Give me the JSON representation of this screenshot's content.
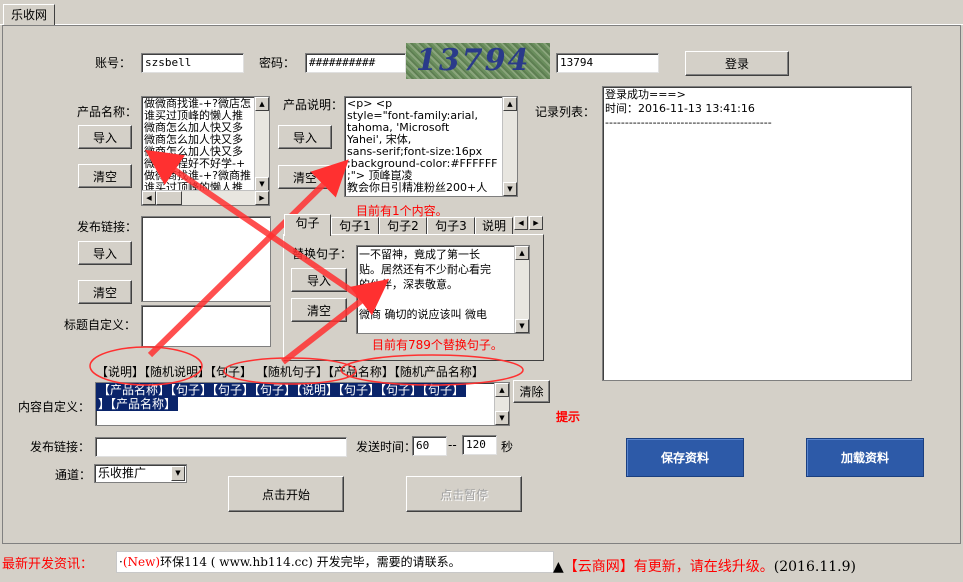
{
  "window": {
    "tab": "乐收网"
  },
  "account": {
    "label": "账号：",
    "value": "szsbell"
  },
  "password": {
    "label": "密码：",
    "value": "##########"
  },
  "captcha": {
    "image_text": "13794",
    "value": "13794"
  },
  "login_button": "登录",
  "product_name": {
    "label": "产品名称：",
    "lines": [
      "做微商找谁-+?微店怎",
      "谁买过顶峰的懒人推",
      "微商怎么加人快又多",
      "微商怎么加人快又多",
      "微商怎么加人快又多",
      "微商小程好不好学-+",
      "做微商找谁-+?微商推",
      "谁买过顶峰的懒人推"
    ],
    "import": "导入",
    "clear": "清空"
  },
  "product_desc": {
    "label": "产品说明：",
    "lines": [
      "<p>      <p",
      "style=\"font-family:arial,",
      "tahoma, 'Microsoft",
      "Yahei', 宋体,",
      "sans-serif;font-size:16px",
      ";background-color:#FFFFFF",
      ";\">           顶峰崑凌",
      "教会你日引精准粉丝200+人"
    ],
    "import": "导入",
    "clear": "清空",
    "status": "目前有1个内容。"
  },
  "record_list": {
    "label": "记录列表：",
    "lines": [
      "登录成功===>",
      "时间：2016-11-13 13:41:16",
      "------------------------------------------"
    ]
  },
  "publish_link": {
    "label": "发布链接：",
    "import": "导入",
    "clear": "清空"
  },
  "title_custom": {
    "label": "标题自定义："
  },
  "sentence_tabs": [
    "句子",
    "句子1",
    "句子2",
    "句子3",
    "说明"
  ],
  "replace_sentence": {
    "label": "替换句子：",
    "lines": [
      "一不留神，竟成了第一长",
      "贴。居然还有不少耐心看完",
      "的伙伴，深表敬意。",
      "",
      "微商 确切的说应该叫 微电"
    ],
    "import": "导入",
    "clear": "清空",
    "status": "目前有789个替换句子。"
  },
  "variables": "【说明】【随机说明】【句子】 【随机句子】【产品名称】【随机产品名称】",
  "content_custom": {
    "label": "内容自定义：",
    "lines": [
      "【产品名称】【句子】【句子】【句子】【说明】【句子】【句子】【句子】",
      "】【产品名称】"
    ],
    "clear": "清除",
    "hint": "提示"
  },
  "publish_link2": {
    "label": "发布链接：",
    "value": ""
  },
  "send_time": {
    "label": "发送时间：",
    "from": "60",
    "sep": "--",
    "to": "120",
    "unit": "秒"
  },
  "channel": {
    "label": "通道：",
    "value": "乐收推广"
  },
  "start_button": "点击开始",
  "pause_button": "点击暂停",
  "save_button": "保存资料",
  "load_button": "加载资料",
  "footer": {
    "news_label": "最新开发资讯：",
    "news_prefix": "·",
    "news_new": "(New)",
    "news_text": "环保114 ( www.hb114.cc) 开发完毕，需要的请联系。",
    "update_marker": "▲",
    "update_red": "【云商网】有更新，请在线升级。",
    "update_date": "(2016.11.9)"
  },
  "colors": {
    "bg": "#d4d0c8",
    "accent_red": "#ff0000",
    "button_blue": "#2d5aa8",
    "selection": "#0a246a"
  },
  "icons": [
    "arrow-up-icon",
    "arrow-down-icon",
    "arrow-left-icon",
    "arrow-right-icon",
    "dropdown-icon"
  ]
}
